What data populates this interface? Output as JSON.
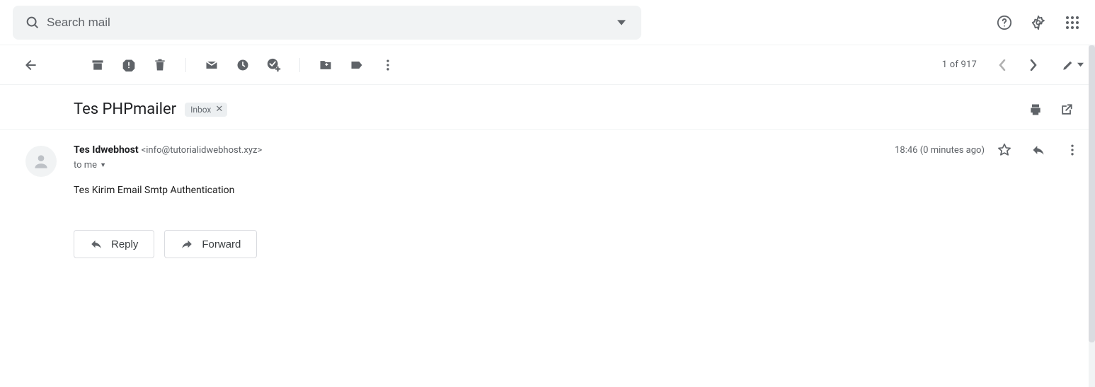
{
  "search": {
    "placeholder": "Search mail"
  },
  "toolbar": {
    "counter": "1 of 917"
  },
  "subject": {
    "text": "Tes PHPmailer",
    "chip_label": "Inbox"
  },
  "sender": {
    "name": "Tes Idwebhost",
    "email": "<info@tutorialidwebhost.xyz>",
    "to": "to me"
  },
  "time": "18:46 (0 minutes ago)",
  "body": "Tes Kirim Email Smtp Authentication",
  "actions": {
    "reply": "Reply",
    "forward": "Forward"
  }
}
